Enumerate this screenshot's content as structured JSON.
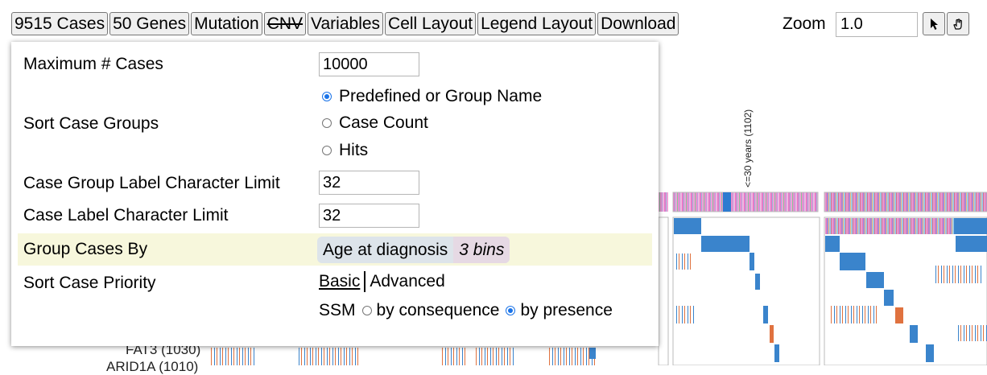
{
  "toolbar": {
    "cases": "9515 Cases",
    "genes": "50 Genes",
    "mutation": "Mutation",
    "cnv": "CNV",
    "variables": "Variables",
    "cell_layout": "Cell Layout",
    "legend_layout": "Legend Layout",
    "download": "Download",
    "zoom_label": "Zoom",
    "zoom_value": "1.0"
  },
  "background": {
    "group_label": "<=30 years (1102)",
    "gene_rows": [
      "FAT3 (1030)",
      "ARID1A (1010)"
    ]
  },
  "menu": {
    "max_cases_label": "Maximum # Cases",
    "max_cases_value": "10000",
    "sort_groups_label": "Sort Case Groups",
    "sort_group_options": [
      "Predefined or Group Name",
      "Case Count",
      "Hits"
    ],
    "group_label_limit_label": "Case Group Label Character Limit",
    "group_label_limit_value": "32",
    "case_label_limit_label": "Case Label Character Limit",
    "case_label_limit_value": "32",
    "group_by_label": "Group Cases By",
    "group_by_value": "Age at diagnosis",
    "group_by_bins": "3 bins",
    "sort_priority_label": "Sort Case Priority",
    "sort_priority_basic": "Basic",
    "sort_priority_advanced": "Advanced",
    "ssm_label": "SSM",
    "ssm_option_consequence": "by consequence",
    "ssm_option_presence": "by presence"
  }
}
